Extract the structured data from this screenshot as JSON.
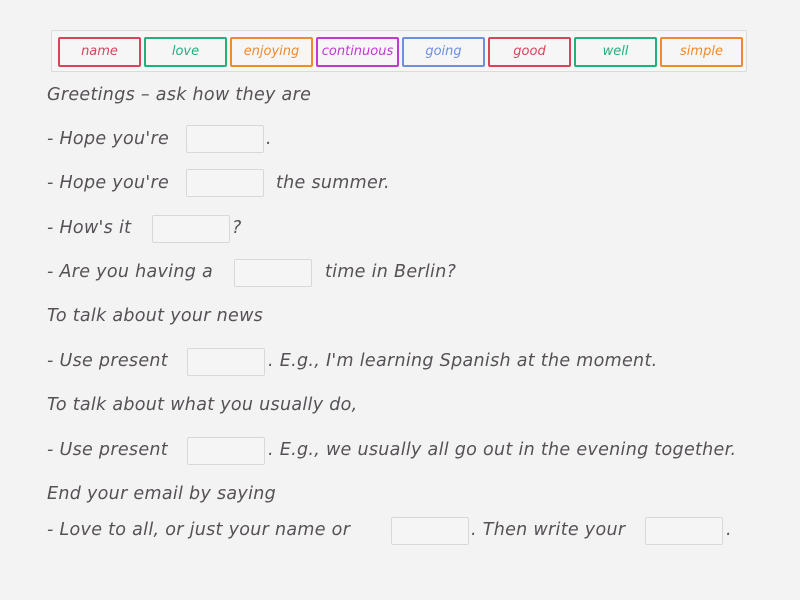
{
  "word_bank": {
    "pieces": [
      {
        "label": "name",
        "color": "#d9445a"
      },
      {
        "label": "love",
        "color": "#22b07d"
      },
      {
        "label": "enjoying",
        "color": "#f08a2c"
      },
      {
        "label": "continuous",
        "color": "#c03ad0"
      },
      {
        "label": "going",
        "color": "#6e8fdd"
      },
      {
        "label": "good",
        "color": "#d9445a"
      },
      {
        "label": "well",
        "color": "#22b07d"
      },
      {
        "label": "simple",
        "color": "#f08a2c"
      }
    ]
  },
  "exercise": {
    "line1": {
      "text": "Greetings – ask how they are"
    },
    "line2": {
      "before": "- Hope you're",
      "after": "."
    },
    "line3": {
      "before": "- Hope you're",
      "after": "the summer."
    },
    "line4": {
      "before": "- How's it",
      "after": "?"
    },
    "line5": {
      "before": "- Are you having a",
      "after": "time in Berlin?"
    },
    "line6": {
      "text": "To talk about your news"
    },
    "line7": {
      "before": "- Use present",
      "after": ". E.g., I'm learning Spanish at the moment."
    },
    "line8": {
      "text": "To talk about what you usually do,"
    },
    "line9": {
      "before": "- Use present",
      "after": ". E.g., we usually all go out in the evening together."
    },
    "line10": {
      "text": "End your email by saying"
    },
    "line11": {
      "before": "- Love to all, or just your name or",
      "middle": ". Then write your",
      "after": "."
    }
  }
}
